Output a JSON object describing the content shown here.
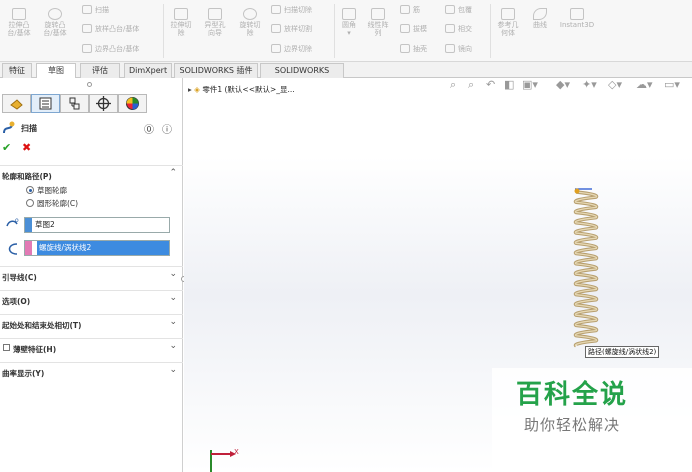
{
  "ribbon": {
    "extrude_boss": "拉伸凸\n台/基体",
    "revolve_boss": "旋转凸\n台/基体",
    "sweep": "扫描",
    "loft_boss": "放样凸台/基体",
    "boundary_boss": "边界凸台/基体",
    "extrude_cut": "拉伸切\n除",
    "hole_wizard": "异型孔\n向导",
    "revolve_cut": "旋转切\n除",
    "swept_cut": "扫描切除",
    "lofted_cut": "放样切割",
    "boundary_cut": "边界切除",
    "fillet": "圆角",
    "linear_pattern": "线性阵\n列",
    "rib": "筋",
    "draft": "拔模",
    "shell": "抽壳",
    "wrap": "包覆",
    "intersect": "相交",
    "mirror": "镜向",
    "reference_geometry": "参考几\n何体",
    "curves": "曲线",
    "instant3d": "Instant3D"
  },
  "tabs": [
    "特征",
    "草图",
    "评估",
    "DimXpert",
    "SOLIDWORKS 插件",
    "SOLIDWORKS MBD"
  ],
  "active_tab": 1,
  "panel": {
    "title": "扫描",
    "profile_path_label": "轮廓和路径(P)",
    "radio_sketch_profile": "草图轮廓",
    "radio_circular_profile": "圆形轮廓(C)",
    "profile_value": "草图2",
    "path_value": "螺旋线/涡状线2",
    "guide_curves_label": "引导线(C)",
    "options_label": "选项(O)",
    "tangency_label": "起始处和结束处相切(T)",
    "thin_feature_label": "薄壁特征(H)",
    "curvature_label": "曲率显示(Y)"
  },
  "viewport": {
    "tree_label": "零件1 (默认<<默认>_显...",
    "callout": "路径(螺旋线/涡状线2)",
    "axis_x": "X"
  },
  "watermark": {
    "brand": "百科全说",
    "tagline": "助你轻松解决"
  },
  "colors": {
    "ok_green": "#26a126",
    "cancel_red": "#dd1111",
    "selection_blue": "#3d8be0",
    "profile_mark": "#4b8fd6",
    "path_mark": "#e27ab5",
    "spring": "#c9b48a",
    "watermark_green": "#24a24a"
  }
}
